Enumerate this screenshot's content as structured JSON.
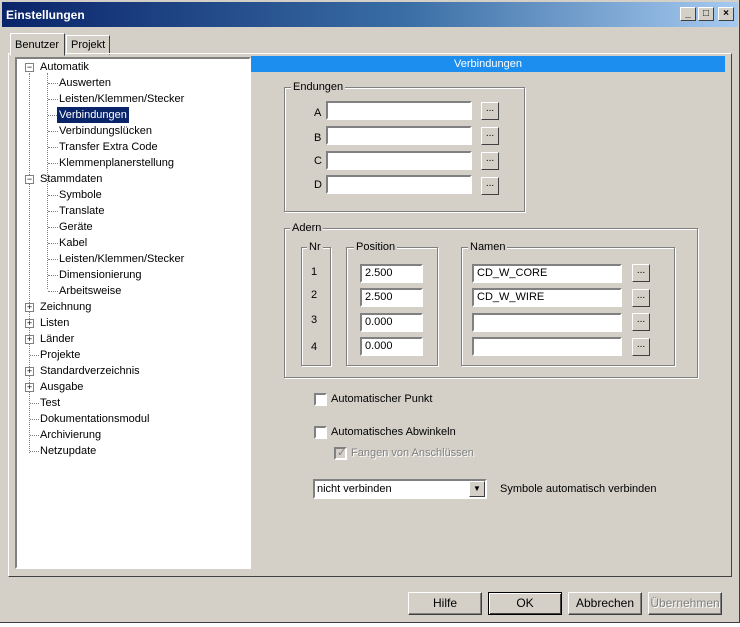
{
  "window": {
    "title": "Einstellungen"
  },
  "title_buttons": {
    "minimize": "_",
    "maximize": "□",
    "close": "×"
  },
  "tabs": [
    {
      "label": "Benutzer"
    },
    {
      "label": "Projekt"
    }
  ],
  "tree": {
    "items": [
      {
        "label": "Automatik",
        "expander": "−"
      },
      {
        "label": "Auswerten"
      },
      {
        "label": "Leisten/Klemmen/Stecker"
      },
      {
        "label": "Verbindungen",
        "selected": true
      },
      {
        "label": "Verbindungslücken"
      },
      {
        "label": "Transfer Extra Code"
      },
      {
        "label": "Klemmenplanerstellung"
      },
      {
        "label": "Stammdaten",
        "expander": "−"
      },
      {
        "label": "Symbole"
      },
      {
        "label": "Translate"
      },
      {
        "label": "Geräte"
      },
      {
        "label": "Kabel"
      },
      {
        "label": "Leisten/Klemmen/Stecker"
      },
      {
        "label": "Dimensionierung"
      },
      {
        "label": "Arbeitsweise"
      },
      {
        "label": "Zeichnung",
        "expander": "+"
      },
      {
        "label": "Listen",
        "expander": "+"
      },
      {
        "label": "Länder",
        "expander": "+"
      },
      {
        "label": "Projekte"
      },
      {
        "label": "Standardverzeichnis",
        "expander": "+"
      },
      {
        "label": "Ausgabe",
        "expander": "+"
      },
      {
        "label": "Test"
      },
      {
        "label": "Dokumentationsmodul"
      },
      {
        "label": "Archivierung"
      },
      {
        "label": "Netzupdate"
      }
    ]
  },
  "panel": {
    "header": "Verbindungen",
    "endungen": {
      "label": "Endungen",
      "rows": [
        {
          "label": "A",
          "value": ""
        },
        {
          "label": "B",
          "value": ""
        },
        {
          "label": "C",
          "value": ""
        },
        {
          "label": "D",
          "value": ""
        }
      ],
      "browse_label": "..."
    },
    "adern": {
      "label": "Adern",
      "nr_label": "Nr",
      "position_label": "Position",
      "namen_label": "Namen",
      "rows": [
        {
          "nr": "1",
          "position": "2.500",
          "name": "CD_W_CORE"
        },
        {
          "nr": "2",
          "position": "2.500",
          "name": "CD_W_WIRE"
        },
        {
          "nr": "3",
          "position": "0.000",
          "name": ""
        },
        {
          "nr": "4",
          "position": "0.000",
          "name": ""
        }
      ],
      "browse_label": "..."
    },
    "auto_punkt": {
      "label": "Automatischer Punkt",
      "checked": false
    },
    "auto_abwinkeln": {
      "label": "Automatisches Abwinkeln",
      "checked": false
    },
    "fangen": {
      "label": "Fangen von Anschlüssen",
      "checked": true,
      "disabled": true,
      "mark": "✓"
    },
    "verbinden_select": {
      "value": "nicht verbinden",
      "arrow": "▼"
    },
    "verbinden_label": "Symbole automatisch verbinden"
  },
  "buttons": {
    "help": "Hilfe",
    "ok": "OK",
    "cancel": "Abbrechen",
    "apply": "Übernehmen"
  }
}
